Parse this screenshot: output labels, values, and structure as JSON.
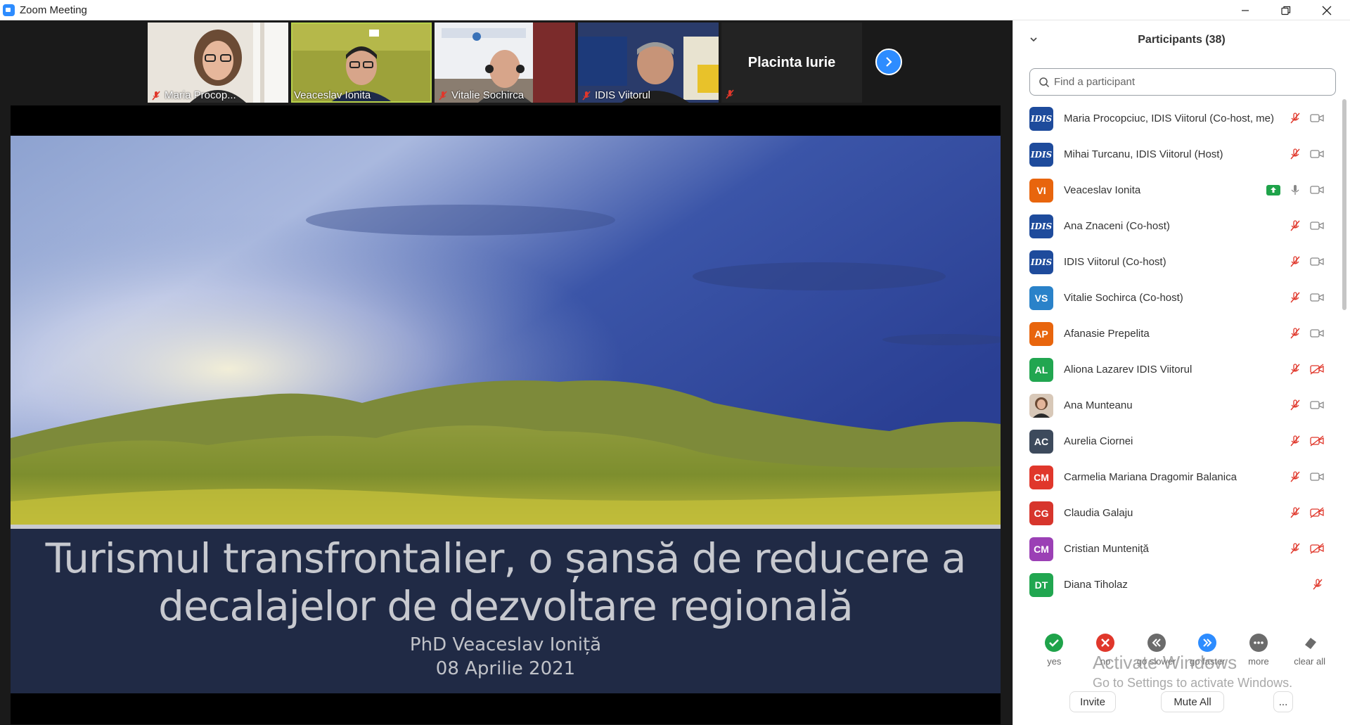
{
  "window": {
    "title": "Zoom Meeting"
  },
  "thumbnails": [
    {
      "name": "Maria Procop...",
      "muted": true
    },
    {
      "name": "Veaceslav Ionita",
      "muted": false,
      "active": true
    },
    {
      "name": "Vitalie Sochirca",
      "muted": true
    },
    {
      "name": "IDIS Viitorul",
      "muted": true
    }
  ],
  "name_tile": {
    "name": "Placinta Iurie",
    "muted": true
  },
  "slide": {
    "title_line1": "Turismul transfrontalier, o șansă de reducere a",
    "title_line2": "decalajelor de dezvoltare regională",
    "author": "PhD Veaceslav Ioniță",
    "date": "08 Aprilie 2021"
  },
  "participants_panel": {
    "title": "Participants (38)",
    "search_placeholder": "Find a participant",
    "participants": [
      {
        "name": "Maria Procopciuc, IDIS Viitorul (Co-host, me)",
        "avatar": "IDIS",
        "avatar_type": "idis",
        "mic": "muted",
        "video": "on"
      },
      {
        "name": "Mihai Turcanu, IDIS Viitorul (Host)",
        "avatar": "IDIS",
        "avatar_type": "idis",
        "mic": "muted",
        "video": "on"
      },
      {
        "name": "Veaceslav Ionita",
        "avatar": "VI",
        "color": "#e8650d",
        "mic": "on",
        "video": "on",
        "sharing": true
      },
      {
        "name": "Ana Znaceni (Co-host)",
        "avatar": "IDIS",
        "avatar_type": "idis",
        "mic": "muted",
        "video": "on"
      },
      {
        "name": "IDIS Viitorul (Co-host)",
        "avatar": "IDIS",
        "avatar_type": "idis",
        "mic": "muted",
        "video": "on"
      },
      {
        "name": "Vitalie Sochirca (Co-host)",
        "avatar": "VS",
        "color": "#2a82c9",
        "mic": "muted",
        "video": "on"
      },
      {
        "name": "Afanasie Prepelita",
        "avatar": "AP",
        "color": "#e8650d",
        "mic": "muted",
        "video": "on"
      },
      {
        "name": "Aliona Lazarev IDIS Viitorul",
        "avatar": "AL",
        "color": "#21a650",
        "mic": "muted",
        "video": "off"
      },
      {
        "name": "Ana Munteanu",
        "avatar": "",
        "avatar_type": "photo",
        "mic": "muted",
        "video": "on"
      },
      {
        "name": "Aurelia Ciornei",
        "avatar": "AC",
        "color": "#3d4a5c",
        "mic": "muted",
        "video": "off"
      },
      {
        "name": "Carmelia Mariana Dragomir Balanica",
        "avatar": "CM",
        "color": "#e0372b",
        "mic": "muted",
        "video": "on"
      },
      {
        "name": "Claudia Galaju",
        "avatar": "CG",
        "color": "#d7352c",
        "mic": "muted",
        "video": "off"
      },
      {
        "name": "Cristian Munteniță",
        "avatar": "CM",
        "color": "#9b40b5",
        "mic": "muted",
        "video": "off"
      },
      {
        "name": "Diana Tiholaz",
        "avatar": "DT",
        "color": "#21a650",
        "mic": "muted",
        "video": "none"
      }
    ],
    "reactions": [
      {
        "label": "yes",
        "icon": "check-icon",
        "color": "#1fa34a"
      },
      {
        "label": "no",
        "icon": "x-icon",
        "color": "#e0372b"
      },
      {
        "label": "go slower",
        "icon": "rewind-icon",
        "color": "#6b6b6b"
      },
      {
        "label": "go faster",
        "icon": "fast-forward-icon",
        "color": "#2d8cff"
      },
      {
        "label": "more",
        "icon": "more-icon",
        "color": "#6b6b6b"
      },
      {
        "label": "clear all",
        "icon": "eraser-icon",
        "color": "#6b6b6b"
      }
    ],
    "watermark_line1": "Activate Windows",
    "watermark_line2": "Go to Settings to activate Windows.",
    "buttons": {
      "invite": "Invite",
      "mute_all": "Mute All",
      "more": "..."
    }
  }
}
